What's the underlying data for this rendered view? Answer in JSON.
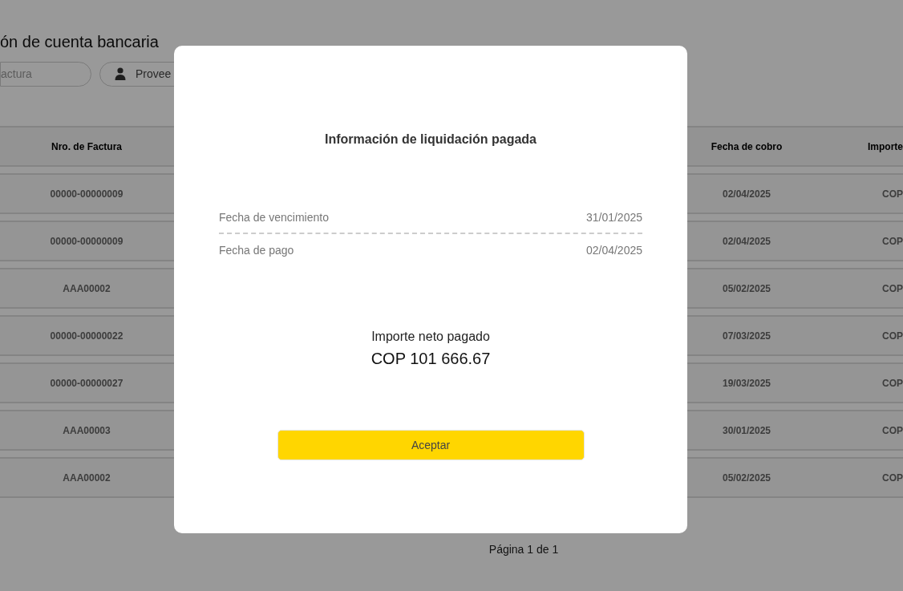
{
  "page": {
    "title": "ón de cuenta bancaria",
    "filters": [
      {
        "kind": "field",
        "placeholder": "actura"
      },
      {
        "kind": "button",
        "label": "Provee"
      }
    ],
    "table": {
      "columns": [
        "Nro. de Factura",
        "Fecha de cobro",
        "Importe"
      ],
      "rows": [
        [
          "00000-00000009",
          "02/04/2025",
          "COP"
        ],
        [
          "00000-00000009",
          "02/04/2025",
          "COP"
        ],
        [
          "AAA00002",
          "05/02/2025",
          "COP"
        ],
        [
          "00000-00000022",
          "07/03/2025",
          "COP"
        ],
        [
          "00000-00000027",
          "19/03/2025",
          "COP"
        ],
        [
          "AAA00003",
          "30/01/2025",
          "COP"
        ],
        [
          "AAA00002",
          "05/02/2025",
          "COP"
        ]
      ]
    },
    "pagination": "Página 1 de 1"
  },
  "dialog": {
    "title": "Información de liquidación pagada",
    "details": [
      {
        "label": "Fecha de vencimiento",
        "value": "31/01/2025"
      },
      {
        "label": "Fecha de pago",
        "value": "02/04/2025"
      }
    ],
    "total_label": "Importe neto pagado",
    "total_value": "COP 101 666.67",
    "button": "Aceptar"
  }
}
